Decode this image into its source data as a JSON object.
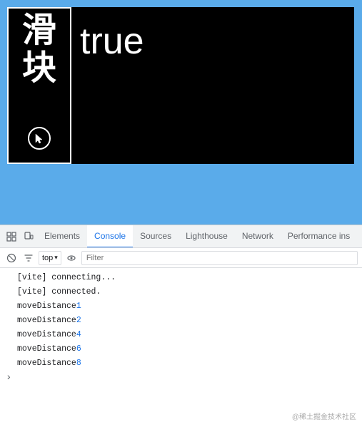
{
  "viewport": {
    "bg_color": "#5aabea"
  },
  "app": {
    "chinese_chars": [
      "滑",
      "块"
    ],
    "value_text": "true"
  },
  "devtools": {
    "tabs": [
      {
        "label": "Elements",
        "active": false
      },
      {
        "label": "Console",
        "active": true
      },
      {
        "label": "Sources",
        "active": false
      },
      {
        "label": "Lighthouse",
        "active": false
      },
      {
        "label": "Network",
        "active": false
      },
      {
        "label": "Performance ins",
        "active": false
      }
    ],
    "toolbar": {
      "top_label": "top",
      "filter_placeholder": "Filter"
    },
    "console_lines": [
      {
        "text": "[vite] connecting...",
        "has_number": false,
        "number": ""
      },
      {
        "text": "[vite] connected.",
        "has_number": false,
        "number": ""
      },
      {
        "text": "moveDistance ",
        "has_number": true,
        "number": "1"
      },
      {
        "text": "moveDistance ",
        "has_number": true,
        "number": "2"
      },
      {
        "text": "moveDistance ",
        "has_number": true,
        "number": "4"
      },
      {
        "text": "moveDistance ",
        "has_number": true,
        "number": "6"
      },
      {
        "text": "moveDistance ",
        "has_number": true,
        "number": "8"
      }
    ]
  },
  "watermark": "@稀土掘金技术社区"
}
